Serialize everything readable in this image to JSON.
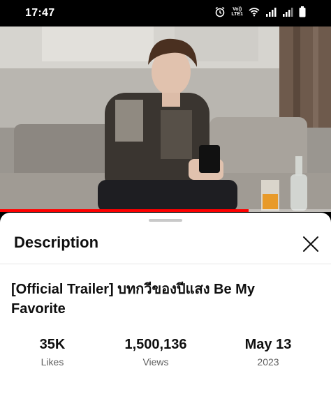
{
  "status_bar": {
    "time": "17:47",
    "volte_top": "Vo))",
    "volte_bottom": "LTE1",
    "icons": [
      "alarm-icon",
      "volte-icon",
      "wifi-icon",
      "signal-icon",
      "signal-icon",
      "battery-icon"
    ]
  },
  "video": {
    "progress": 0.75,
    "accent_color": "#ff0000"
  },
  "sheet": {
    "title": "Description",
    "close_icon": "close-icon",
    "video_title": "[Official Trailer] บทกวีของปีแสง Be My Favorite",
    "stats": [
      {
        "value": "35K",
        "label": "Likes"
      },
      {
        "value": "1,500,136",
        "label": "Views"
      },
      {
        "value": "May 13",
        "label": "2023"
      }
    ]
  }
}
